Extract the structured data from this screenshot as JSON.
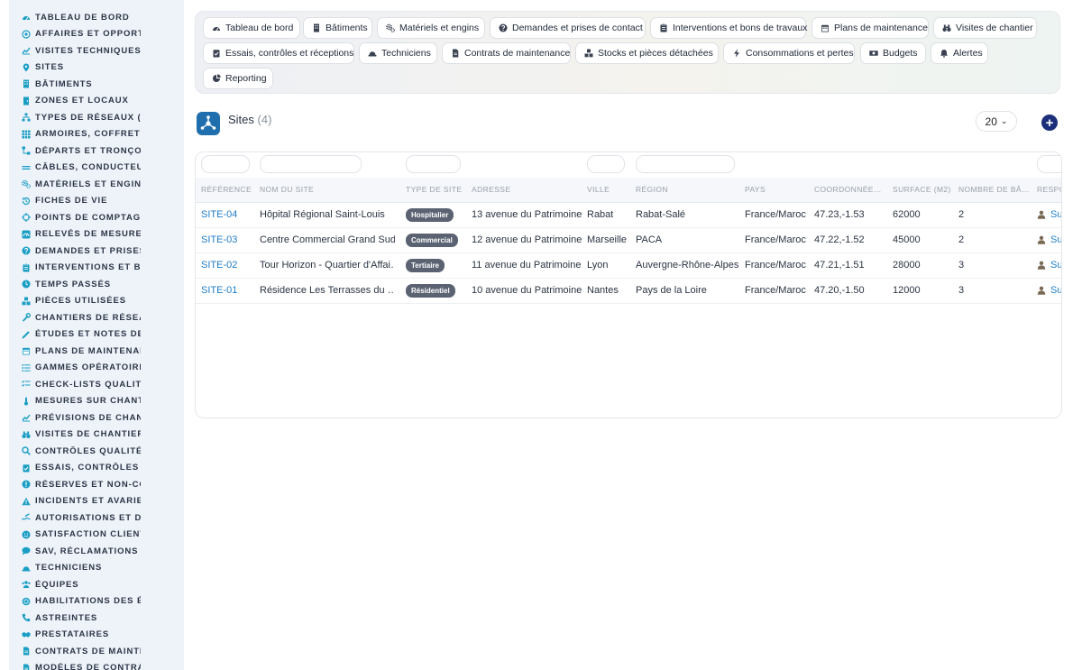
{
  "sidebar": {
    "items": [
      {
        "label": "TABLEAU DE BORD",
        "icon": "dashboard-icon"
      },
      {
        "label": "AFFAIRES ET OPPORTUNITÉS",
        "icon": "target-icon"
      },
      {
        "label": "VISITES TECHNIQUES ET AUDITS",
        "icon": "chart-line-icon"
      },
      {
        "label": "SITES",
        "icon": "map-pin-icon"
      },
      {
        "label": "BÂTIMENTS",
        "icon": "building-icon"
      },
      {
        "label": "ZONES ET LOCAUX",
        "icon": "door-icon"
      },
      {
        "label": "TYPES DE RÉSEAUX (BT / HTA)",
        "icon": "network-icon"
      },
      {
        "label": "ARMOIRES, COFFRETS ET TABLEAUX",
        "icon": "grid-icon"
      },
      {
        "label": "DÉPARTS ET TRONÇONS",
        "icon": "diagram-icon"
      },
      {
        "label": "CÂBLES, CONDUCTEURS",
        "icon": "lines-icon"
      },
      {
        "label": "MATÉRIELS ET ENGINS",
        "icon": "gears-icon"
      },
      {
        "label": "FICHES DE VIE",
        "icon": "history-icon"
      },
      {
        "label": "POINTS DE COMPTAGE ET MESURE",
        "icon": "crosshair-icon"
      },
      {
        "label": "RELEVÉS DE MESURES",
        "icon": "gauge-icon"
      },
      {
        "label": "DEMANDES ET PRISES DE CONTACT",
        "icon": "question-icon"
      },
      {
        "label": "INTERVENTIONS ET BONS DE TRAVAUX",
        "icon": "clipboard-icon"
      },
      {
        "label": "TEMPS PASSÉS",
        "icon": "clock-icon"
      },
      {
        "label": "PIÈCES UTILISÉES",
        "icon": "cubes-icon"
      },
      {
        "label": "CHANTIERS DE RÉSEAUX",
        "icon": "wrench-icon"
      },
      {
        "label": "ÉTUDES ET NOTES DE CALCUL",
        "icon": "pencil-ruler-icon"
      },
      {
        "label": "PLANS DE MAINTENANCE",
        "icon": "calendar-icon"
      },
      {
        "label": "GAMMES OPÉRATOIRES",
        "icon": "list-icon"
      },
      {
        "label": "CHECK-LISTS QUALITÉ",
        "icon": "checklist-icon"
      },
      {
        "label": "MESURES SUR CHANTIER",
        "icon": "thermometer-icon"
      },
      {
        "label": "PRÉVISIONS DE CHANTIER",
        "icon": "chart-line-icon"
      },
      {
        "label": "VISITES DE CHANTIER",
        "icon": "binoculars-icon"
      },
      {
        "label": "CONTRÔLES QUALITÉ",
        "icon": "search-icon"
      },
      {
        "label": "ESSAIS, CONTRÔLES ET RÉCEPTIONS",
        "icon": "clipboard-check-icon"
      },
      {
        "label": "RÉSERVES ET NON-CONFORMITÉS",
        "icon": "alert-circle-icon"
      },
      {
        "label": "INCIDENTS ET AVARIES",
        "icon": "warning-icon"
      },
      {
        "label": "AUTORISATIONS ET DICT",
        "icon": "signature-icon"
      },
      {
        "label": "SATISFACTION CLIENT",
        "icon": "smile-icon"
      },
      {
        "label": "SAV, RÉCLAMATIONS ET GARANTIES",
        "icon": "chat-icon"
      },
      {
        "label": "TECHNICIENS",
        "icon": "hard-hat-icon"
      },
      {
        "label": "ÉQUIPES",
        "icon": "users-icon"
      },
      {
        "label": "HABILITATIONS DES ÉQUIPES",
        "icon": "certificate-icon"
      },
      {
        "label": "ASTREINTES",
        "icon": "phone-icon"
      },
      {
        "label": "PRESTATAIRES",
        "icon": "handshake-icon"
      },
      {
        "label": "CONTRATS DE MAINTENANCE",
        "icon": "file-icon"
      },
      {
        "label": "MODÈLES DE CONTRATS",
        "icon": "file-icon"
      }
    ]
  },
  "topnav": {
    "tabs": [
      {
        "label": "Tableau de bord",
        "icon": "dashboard-icon"
      },
      {
        "label": "Bâtiments",
        "icon": "building-icon"
      },
      {
        "label": "Matériels et engins",
        "icon": "gears-icon"
      },
      {
        "label": "Demandes et prises de contact",
        "icon": "question-icon"
      },
      {
        "label": "Interventions et bons de travaux",
        "icon": "clipboard-icon"
      },
      {
        "label": "Plans de maintenance",
        "icon": "calendar-icon"
      },
      {
        "label": "Visites de chantier",
        "icon": "binoculars-icon"
      },
      {
        "label": "Essais, contrôles et réceptions",
        "icon": "clipboard-check-icon"
      },
      {
        "label": "Techniciens",
        "icon": "hard-hat-icon"
      },
      {
        "label": "Contrats de maintenance",
        "icon": "file-icon"
      },
      {
        "label": "Stocks et pièces détachées",
        "icon": "cubes-icon"
      },
      {
        "label": "Consommations et pertes",
        "icon": "bolt-icon"
      },
      {
        "label": "Budgets",
        "icon": "money-icon"
      },
      {
        "label": "Alertes",
        "icon": "bell-icon"
      },
      {
        "label": "Reporting",
        "icon": "pie-chart-icon"
      }
    ]
  },
  "sites": {
    "title": "Sites",
    "count": "(4)",
    "page_size": "20",
    "add_icon": "plus-circle-icon"
  },
  "table": {
    "columns": [
      "RÉFÉRENCE",
      "NOM DU SITE",
      "TYPE DE SITE",
      "ADRESSE",
      "VILLE",
      "RÉGION",
      "PAYS",
      "COORDONNÉE…",
      "SURFACE (M2)",
      "NOMBRE DE BÂ…",
      "RESPO"
    ],
    "rows": [
      {
        "ref": "SITE-04",
        "name": "Hôpital Régional Saint-Louis",
        "type": "Hospitalier",
        "address": "13 avenue du Patrimoine",
        "city": "Rabat",
        "region": "Rabat-Salé",
        "country": "France/Maroc",
        "coords": "47.23,-1.53",
        "surface": "62000",
        "buildings": "2",
        "resp": "Su"
      },
      {
        "ref": "SITE-03",
        "name": "Centre Commercial Grand Sud",
        "type": "Commercial",
        "address": "12 avenue du Patrimoine",
        "city": "Marseille",
        "region": "PACA",
        "country": "France/Maroc",
        "coords": "47.22,-1.52",
        "surface": "45000",
        "buildings": "2",
        "resp": "Su"
      },
      {
        "ref": "SITE-02",
        "name": "Tour Horizon - Quartier d'Affai…",
        "type": "Tertiaire",
        "address": "11 avenue du Patrimoine",
        "city": "Lyon",
        "region": "Auvergne-Rhône-Alpes",
        "country": "France/Maroc",
        "coords": "47.21,-1.51",
        "surface": "28000",
        "buildings": "3",
        "resp": "Su"
      },
      {
        "ref": "SITE-01",
        "name": "Résidence Les Terrasses du …",
        "type": "Résidentiel",
        "address": "10 avenue du Patrimoine",
        "city": "Nantes",
        "region": "Pays de la Loire",
        "country": "France/Maroc",
        "coords": "47.20,-1.50",
        "surface": "12000",
        "buildings": "3",
        "resp": "Su"
      }
    ]
  },
  "colors": {
    "accent": "#1a9ec4",
    "link": "#1f7dc7",
    "badge": "#5b6372",
    "primary_button": "#1d2f7a"
  }
}
